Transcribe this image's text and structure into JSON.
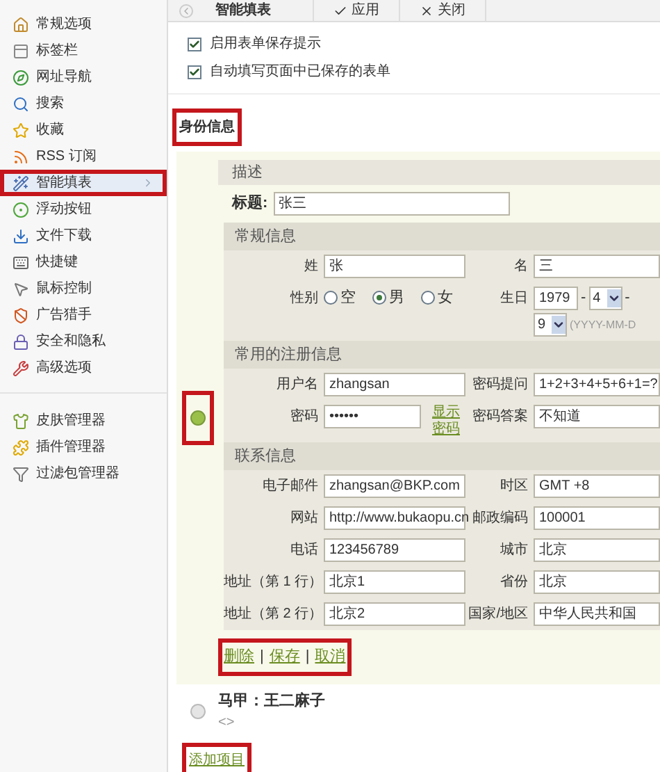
{
  "sidebar": {
    "groups": [
      {
        "items": [
          {
            "label": "常规选项",
            "selected": false,
            "highlighted": false
          },
          {
            "label": "标签栏",
            "selected": false,
            "highlighted": false
          },
          {
            "label": "网址导航",
            "selected": false,
            "highlighted": false
          },
          {
            "label": "搜索",
            "selected": false,
            "highlighted": false
          },
          {
            "label": "收藏",
            "selected": false,
            "highlighted": false
          },
          {
            "label": "RSS 订阅",
            "selected": false,
            "highlighted": false
          },
          {
            "label": "智能填表",
            "selected": true,
            "highlighted": true
          },
          {
            "label": "浮动按钮",
            "selected": false,
            "highlighted": false
          },
          {
            "label": "文件下载",
            "selected": false,
            "highlighted": false
          },
          {
            "label": "快捷键",
            "selected": false,
            "highlighted": false
          },
          {
            "label": "鼠标控制",
            "selected": false,
            "highlighted": false
          },
          {
            "label": "广告猎手",
            "selected": false,
            "highlighted": false
          },
          {
            "label": "安全和隐私",
            "selected": false,
            "highlighted": false
          },
          {
            "label": "高级选项",
            "selected": false,
            "highlighted": false
          }
        ]
      },
      {
        "items": [
          {
            "label": "皮肤管理器",
            "selected": false,
            "highlighted": false
          },
          {
            "label": "插件管理器",
            "selected": false,
            "highlighted": false
          },
          {
            "label": "过滤包管理器",
            "selected": false,
            "highlighted": false
          }
        ]
      }
    ]
  },
  "toolbar": {
    "title": "智能填表",
    "apply": "应用",
    "close": "关闭"
  },
  "options": [
    {
      "label": "启用表单保存提示",
      "checked": true
    },
    {
      "label": "自动填写页面中已保存的表单",
      "checked": true
    }
  ],
  "heading": {
    "text": "身份信息",
    "highlighted": true
  },
  "profiles": [
    {
      "selected": true,
      "highlighted": true,
      "expanded": true,
      "description_header": "描述",
      "title_label": "标题:",
      "title_value": "张三",
      "sections": [
        {
          "title": "常规信息",
          "rows": [
            [
              {
                "label": "姓",
                "kind": "text",
                "value": "张"
              },
              {
                "label": "名",
                "kind": "text",
                "value": "三"
              }
            ],
            [
              {
                "label": "性别",
                "kind": "radios",
                "options": [
                  {
                    "label": "空",
                    "selected": false
                  },
                  {
                    "label": "男",
                    "selected": true
                  },
                  {
                    "label": "女",
                    "selected": false
                  }
                ]
              },
              {
                "label": "生日",
                "kind": "date",
                "year": "1979",
                "separators": [
                  "-",
                  "-"
                ],
                "month": "4",
                "day": "9",
                "hint": "(YYYY-MM-D"
              }
            ]
          ]
        },
        {
          "title": "常用的注册信息",
          "rows": [
            [
              {
                "label": "用户名",
                "kind": "text",
                "value": "zhangsan"
              },
              {
                "label": "密码提问",
                "kind": "text",
                "value": "1+2+3+4+5+6+1=?"
              }
            ],
            [
              {
                "label": "密码",
                "kind": "password",
                "value": "••••••",
                "link": "显示密码"
              },
              {
                "label": "密码答案",
                "kind": "text",
                "value": "不知道"
              }
            ]
          ]
        },
        {
          "title": "联系信息",
          "rows": [
            [
              {
                "label": "电子邮件",
                "kind": "text",
                "value": "zhangsan@BKP.com"
              },
              {
                "label": "时区",
                "kind": "text",
                "value": "GMT +8"
              }
            ],
            [
              {
                "label": "网站",
                "kind": "text",
                "value": "http://www.bukaopu.cn"
              },
              {
                "label": "邮政编码",
                "kind": "text",
                "value": "100001"
              }
            ],
            [
              {
                "label": "电话",
                "kind": "text",
                "value": "123456789"
              },
              {
                "label": "城市",
                "kind": "text",
                "value": "北京"
              }
            ],
            [
              {
                "label": "地址（第 1 行）",
                "kind": "text",
                "value": "北京1"
              },
              {
                "label": "省份",
                "kind": "text",
                "value": "北京"
              }
            ],
            [
              {
                "label": "地址（第 2 行）",
                "kind": "text",
                "value": "北京2"
              },
              {
                "label": "国家/地区",
                "kind": "text",
                "value": "中华人民共和国"
              }
            ]
          ]
        }
      ],
      "actions": {
        "highlighted": true,
        "links": [
          "删除",
          "保存",
          "取消"
        ],
        "separator": "|"
      }
    },
    {
      "selected": false,
      "highlighted": false,
      "expanded": false,
      "title": "马甲：王二麻子",
      "description": "<>"
    }
  ],
  "add_link": {
    "text": "添加项目",
    "highlighted": true
  }
}
